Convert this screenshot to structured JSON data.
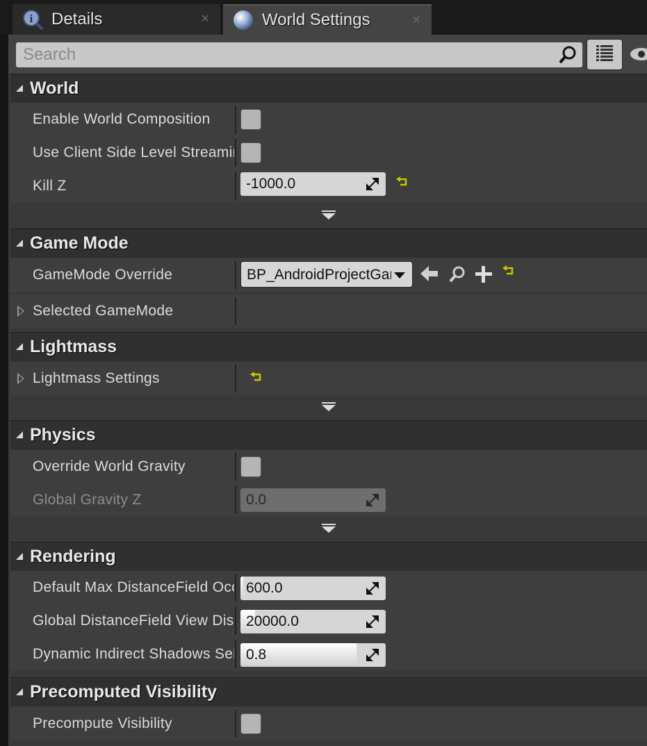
{
  "tabs": [
    {
      "label": "Details",
      "icon": "info-icon",
      "close": "×"
    },
    {
      "label": "World Settings",
      "icon": "globe-icon",
      "close": "×"
    }
  ],
  "search": {
    "placeholder": "Search"
  },
  "sections": {
    "world": {
      "title": "World",
      "rows": [
        {
          "label": "Enable World Composition",
          "checked": false
        },
        {
          "label": "Use Client Side Level Streaming Volumes",
          "checked": false
        },
        {
          "label": "Kill Z",
          "value": "-1000.0"
        }
      ]
    },
    "game_mode": {
      "title": "Game Mode",
      "rows": [
        {
          "label": "GameMode Override",
          "value": "BP_AndroidProjectGameMode"
        },
        {
          "label": "Selected GameMode"
        }
      ]
    },
    "lightmass": {
      "title": "Lightmass",
      "rows": [
        {
          "label": "Lightmass Settings"
        }
      ]
    },
    "physics": {
      "title": "Physics",
      "rows": [
        {
          "label": "Override World Gravity",
          "checked": false
        },
        {
          "label": "Global Gravity Z",
          "value": "0.0"
        }
      ]
    },
    "rendering": {
      "title": "Rendering",
      "rows": [
        {
          "label": "Default Max DistanceField Occlusion Distance",
          "value": "600.0",
          "fill": 0.02
        },
        {
          "label": "Global DistanceField View Distance",
          "value": "20000.0",
          "fill": 0.1
        },
        {
          "label": "Dynamic Indirect Shadows Self Shadowing Intensity",
          "value": "0.8",
          "fill": 0.8
        }
      ]
    },
    "precomputed_visibility": {
      "title": "Precomputed Visibility",
      "rows": [
        {
          "label": "Precompute Visibility",
          "checked": false
        }
      ]
    }
  },
  "colors": {
    "reset_arrow": "#c8c800",
    "panel_bg": "#393939"
  }
}
